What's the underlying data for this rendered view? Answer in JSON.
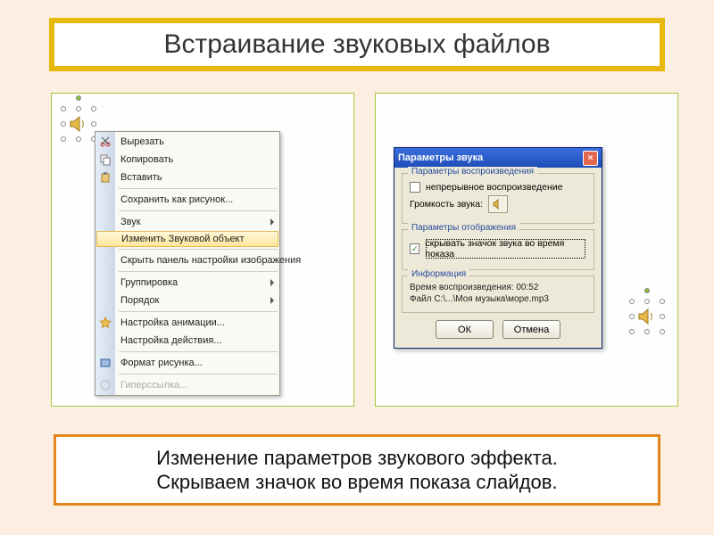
{
  "title": "Встраивание звуковых файлов",
  "caption_line1": "Изменение параметров звукового эффекта.",
  "caption_line2": "Скрываем значок во время показа слайдов.",
  "context_menu": {
    "cut": "Вырезать",
    "copy": "Копировать",
    "paste": "Вставить",
    "save_as_picture": "Сохранить как рисунок...",
    "sound": "Звук",
    "edit_sound_object": "Изменить Звуковой объект",
    "hide_picture_toolbar": "Скрыть панель настройки изображения",
    "grouping": "Группировка",
    "order": "Порядок",
    "custom_animation": "Настройка анимации...",
    "action_settings": "Настройка действия...",
    "format_picture": "Формат рисунка...",
    "hyperlink": "Гиперссылка..."
  },
  "dialog": {
    "title": "Параметры звука",
    "group_playback": "Параметры воспроизведения",
    "loop_label": "непрерывное воспроизведение",
    "loop_checked": false,
    "volume_label": "Громкость звука:",
    "group_display": "Параметры отображения",
    "hide_icon_label": "скрывать значок звука во время показа",
    "hide_icon_checked": true,
    "group_info": "Информация",
    "info_duration": "Время воспроизведения:  00:52",
    "info_file": "Файл   C:\\...\\Моя музыка\\море.mp3",
    "ok": "ОК",
    "cancel": "Отмена"
  }
}
